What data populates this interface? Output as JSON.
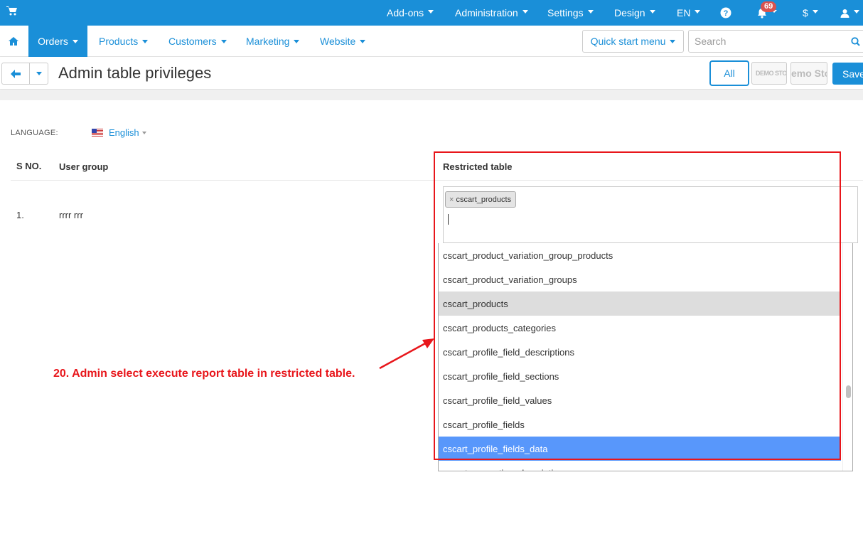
{
  "topbar": {
    "menus": [
      {
        "label": "Add-ons"
      },
      {
        "label": "Administration"
      },
      {
        "label": "Settings"
      },
      {
        "label": "Design"
      },
      {
        "label": "EN"
      }
    ],
    "notification_count": "69",
    "currency": "$"
  },
  "mainnav": {
    "active_tab": "Orders",
    "links": [
      "Products",
      "Customers",
      "Marketing",
      "Website"
    ],
    "quick_start": "Quick start menu",
    "search_placeholder": "Search"
  },
  "titlebar": {
    "title": "Admin table privileges",
    "all_label": "All",
    "store1_label": "DEMO STORE",
    "store2_label": "emo Sto",
    "save_label": "Save"
  },
  "content": {
    "language_label": "LANGUAGE:",
    "language_value": "English",
    "columns": {
      "sno": "S NO.",
      "user_group": "User group",
      "restricted_table": "Restricted table"
    },
    "rows": [
      {
        "sno": "1.",
        "user_group": "rrrr rrr"
      }
    ],
    "selected_chip": "cscart_products",
    "chip_remove": "×",
    "dropdown_options": [
      {
        "label": "cscart_product_variation_group_products",
        "state": "normal"
      },
      {
        "label": "cscart_product_variation_groups",
        "state": "normal"
      },
      {
        "label": "cscart_products",
        "state": "selected"
      },
      {
        "label": "cscart_products_categories",
        "state": "normal"
      },
      {
        "label": "cscart_profile_field_descriptions",
        "state": "normal"
      },
      {
        "label": "cscart_profile_field_sections",
        "state": "normal"
      },
      {
        "label": "cscart_profile_field_values",
        "state": "normal"
      },
      {
        "label": "cscart_profile_fields",
        "state": "normal"
      },
      {
        "label": "cscart_profile_fields_data",
        "state": "highlight"
      },
      {
        "label": "cscart_promotion_descriptions",
        "state": "normal"
      }
    ]
  },
  "annotation": {
    "text": "20. Admin select execute report table in restricted table."
  },
  "colors": {
    "primary": "#1a8fd8",
    "highlight": "#5897fb",
    "annotation": "#e8161b"
  }
}
